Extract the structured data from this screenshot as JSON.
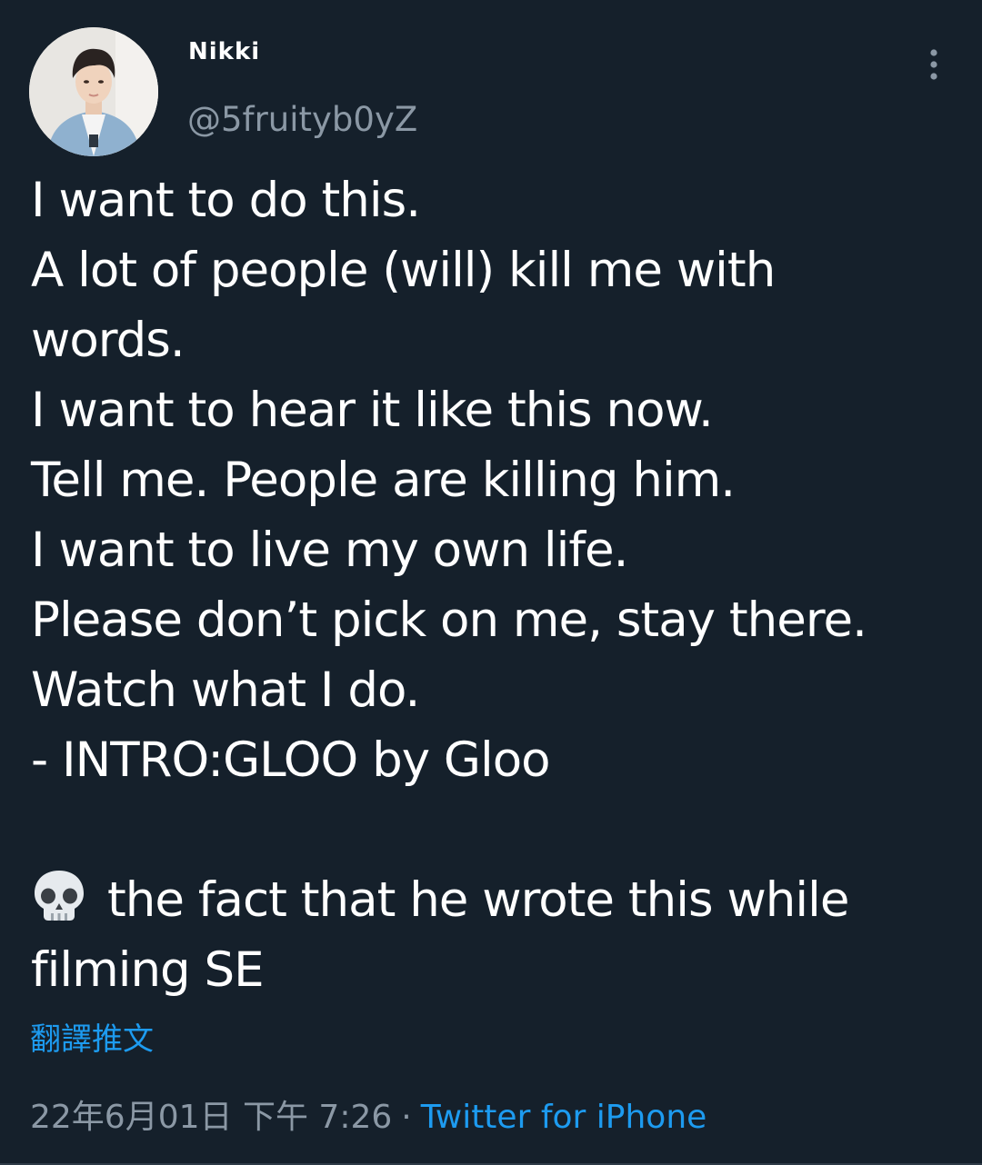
{
  "tweet": {
    "author": {
      "display_name": "Nikki",
      "handle": "@5fruityb0yZ"
    },
    "text_lines": [
      "I want to do this.",
      "A lot of people (will) kill me with",
      "words.",
      "I want to hear it like this now.",
      "Tell me. People are killing him.",
      "I want to live my own life.",
      "Please don’t pick on me, stay there.",
      "Watch what I do.",
      "- INTRO:GLOO by Gloo"
    ],
    "comment_line_1": "the fact that he wrote this while",
    "comment_line_2": "filming SE",
    "translate_label": "翻譯推文",
    "timestamp": "22年6月01日 下午 7:26",
    "separator": "·",
    "source": "Twitter for iPhone"
  },
  "icons": {
    "more": "more-vertical-icon",
    "skull": "skull-emoji-icon"
  },
  "colors": {
    "background": "#15202b",
    "primary_text": "#ffffff",
    "secondary_text": "#8b98a5",
    "link": "#1d9bf0"
  }
}
